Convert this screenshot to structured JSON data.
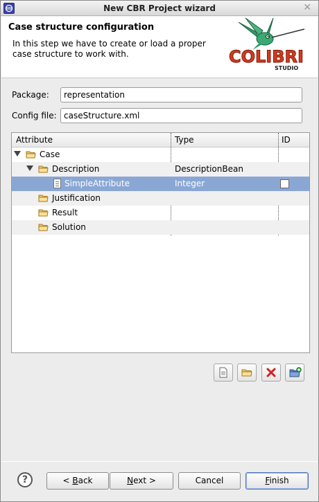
{
  "window": {
    "title": "New CBR Project wizard",
    "close_glyph": "✕"
  },
  "header": {
    "title": "Case structure configuration",
    "description": "In this step we have to create or load a proper case structure to work with.",
    "logo_text": "COLIBRI",
    "logo_sub": "STUDIO"
  },
  "form": {
    "package_label": "Package:",
    "package_value": "representation",
    "config_label": "Config file:",
    "config_value": "caseStructure.xml"
  },
  "tree": {
    "columns": [
      "Attribute",
      "Type",
      "ID"
    ],
    "rows": [
      {
        "label": "Case",
        "type": "",
        "has_id": false
      },
      {
        "label": "Description",
        "type": "DescriptionBean",
        "has_id": false
      },
      {
        "label": "SimpleAttribute",
        "type": "Integer",
        "has_id": true,
        "selected": true
      },
      {
        "label": "Justification",
        "type": "",
        "has_id": false
      },
      {
        "label": "Result",
        "type": "",
        "has_id": false
      },
      {
        "label": "Solution",
        "type": "",
        "has_id": false
      }
    ]
  },
  "buttons": {
    "help": "?",
    "back_prefix": "< ",
    "back_key": "B",
    "back_rest": "ack",
    "next_prefix": "",
    "next_key": "N",
    "next_rest": "ext >",
    "cancel": "Cancel",
    "finish_key": "F",
    "finish_rest": "inish"
  },
  "colors": {
    "selection": "#8aa7d4",
    "logo": "#d63b1f",
    "delete": "#d42020"
  }
}
